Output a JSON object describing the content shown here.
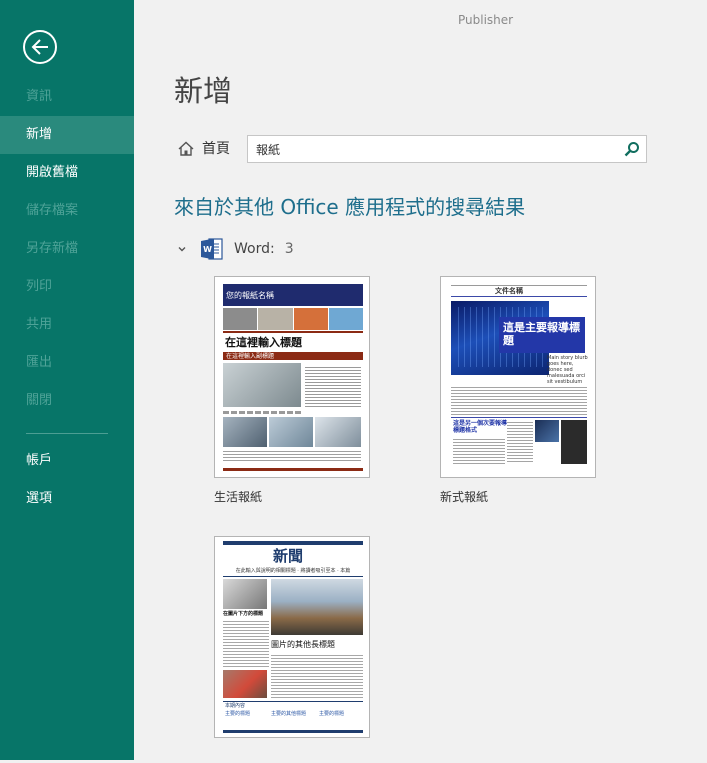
{
  "app_name": "Publisher",
  "sidebar": {
    "items": [
      {
        "label": "資訊",
        "state": "disabled"
      },
      {
        "label": "新增",
        "state": "active"
      },
      {
        "label": "開啟舊檔",
        "state": "normal"
      },
      {
        "label": "儲存檔案",
        "state": "disabled"
      },
      {
        "label": "另存新檔",
        "state": "disabled"
      },
      {
        "label": "列印",
        "state": "disabled"
      },
      {
        "label": "共用",
        "state": "disabled"
      },
      {
        "label": "匯出",
        "state": "disabled"
      },
      {
        "label": "關閉",
        "state": "disabled"
      },
      {
        "label": "帳戶",
        "state": "normal"
      },
      {
        "label": "選項",
        "state": "normal"
      }
    ]
  },
  "main": {
    "title": "新增",
    "home_label": "首頁",
    "search_value": "報紙",
    "results_heading": "來自於其他 Office 應用程式的搜尋結果",
    "group": {
      "app": "Word:",
      "count": "3"
    },
    "templates": [
      {
        "name": "生活報紙",
        "thumb": {
          "masthead": "您的報紙名稱",
          "headline": "在這裡輸入標題",
          "subheading": "在這裡輸入副標題"
        }
      },
      {
        "name": "新式報紙",
        "thumb": {
          "doc_title": "文件名稱",
          "headline": "這是主要報導標題",
          "side_text": "Main story blurb goes here, donec sed malesuada orci sit vestibulum faucibus nulla eu",
          "second_headline": "這是另一個次要報導標題格式"
        }
      },
      {
        "name": "",
        "thumb": {
          "masthead": "新聞",
          "tagline": "在此輸入與說明的相關標題 · 將讀者吸引至本 · 本篇",
          "caption1": "在圖片下方的標題",
          "headline": "圖片的其他長標題",
          "footer_left": "本期內容",
          "footer_items": [
            "主要的標題",
            "主要的其他標題",
            "主要的標題"
          ]
        }
      }
    ]
  },
  "colors": {
    "sidebar": "#077568",
    "sidebar_active": "#2a8a7d",
    "accent_blue": "#1e6e8c",
    "word_blue": "#2b579a",
    "newspaper_navy": "#1f2b6e",
    "newspaper_red": "#8b2a14"
  }
}
